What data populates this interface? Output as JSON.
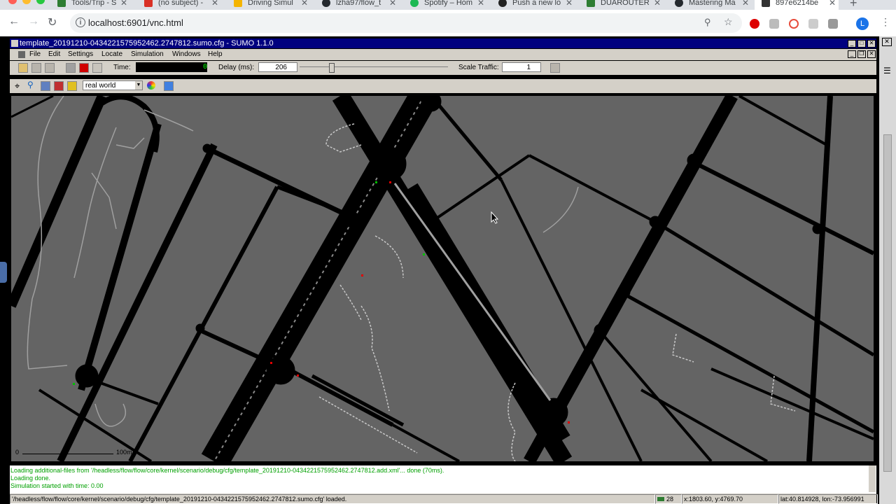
{
  "browser": {
    "tabs": [
      {
        "label": "Tools/Trip - S",
        "active": false
      },
      {
        "label": "(no subject) -",
        "active": false
      },
      {
        "label": "Driving Simul",
        "active": false
      },
      {
        "label": "lzha97/flow_t",
        "active": false
      },
      {
        "label": "Spotify – Hom",
        "active": false
      },
      {
        "label": "Push a new lo",
        "active": false
      },
      {
        "label": "DUAROUTER",
        "active": false
      },
      {
        "label": "Mastering Ma",
        "active": false
      },
      {
        "label": "897e6214be",
        "active": true
      }
    ],
    "url": "localhost:6901/vnc.html",
    "avatar_initial": "L"
  },
  "sumo": {
    "window_title": "template_20191210-0434221575952462.2747812.sumo.cfg - SUMO 1.1.0",
    "menu": [
      "File",
      "Edit",
      "Settings",
      "Locate",
      "Simulation",
      "Windows",
      "Help"
    ],
    "toolbar": {
      "time_label": "Time:",
      "time_value": "0",
      "delay_label": "Delay (ms):",
      "delay_value": "206",
      "scale_label": "Scale Traffic:",
      "scale_value": "1"
    },
    "view_scheme": "real world",
    "scale_bar": {
      "start": "0",
      "end": "100m"
    },
    "messages": [
      "Loading additional-files from '/headless/flow/flow/core/kernel/scenario/debug/cfg/template_20191210-0434221575952462.2747812.add.xml'... done (70ms).",
      "Loading done.",
      "Simulation started with time: 0.00"
    ],
    "status": {
      "loaded": "'/headless/flow/flow/core/kernel/scenario/debug/cfg/template_20191210-0434221575952462.2747812.sumo.cfg' loaded.",
      "vehicles": "28",
      "xy": "x:1803.60, y:4769.70",
      "latlon": "lat:40.814928, lon:-73.956991"
    }
  },
  "colors": {
    "titlebar": "#00007f",
    "map_bg": "#646464",
    "road": "#000000",
    "sidewalk": "#a0a0a0",
    "message": "#00a000"
  }
}
